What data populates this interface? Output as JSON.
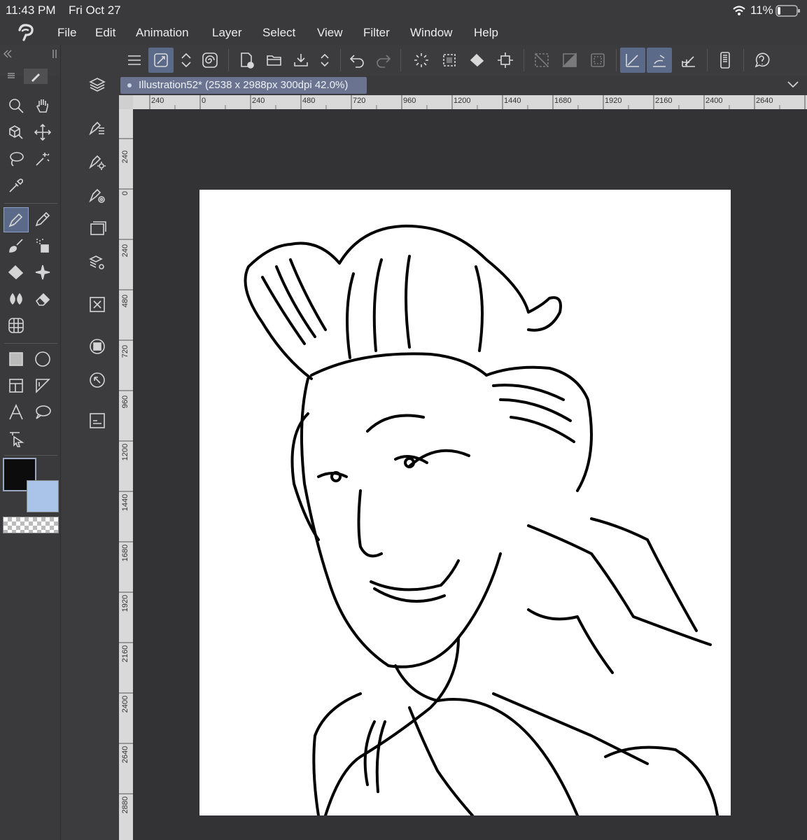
{
  "status_bar": {
    "time": "11:43 PM",
    "date": "Fri Oct 27",
    "battery": "11%"
  },
  "menu": [
    "File",
    "Edit",
    "Animation",
    "Layer",
    "Select",
    "View",
    "Filter",
    "Window",
    "Help"
  ],
  "document_tab": {
    "title": "Illustration52* (2538 x 2988px 300dpi 42.0%)"
  },
  "ruler_h": [
    "240",
    "0",
    "240",
    "480",
    "720",
    "960",
    "1200",
    "1440",
    "1680",
    "1920",
    "2160",
    "2400",
    "2640"
  ],
  "ruler_v": [
    "240",
    "0",
    "240",
    "480",
    "720",
    "960",
    "1200",
    "1440",
    "1680",
    "1920",
    "2160",
    "2400",
    "2640",
    "2880"
  ],
  "colors": {
    "main": "#0c0c0c",
    "sub": "#a9c4e8",
    "accent": "#5a6a88"
  },
  "toolbar_icons": [
    "menu-icon",
    "brush-settings-icon",
    "toggle-icon",
    "spiral-icon",
    "new-file-icon",
    "open-folder-icon",
    "save-icon",
    "updown-icon",
    "undo-icon",
    "redo-icon",
    "loading-icon",
    "select-all-icon",
    "fill-icon",
    "transform-icon",
    "deselect-icon",
    "invert-icon",
    "selection-border-icon",
    "ruler-snap-icon",
    "brush-snap-icon",
    "grid-snap-icon",
    "device-icon",
    "help-icon"
  ],
  "tools": [
    "zoom-icon",
    "hand-icon",
    "object-icon",
    "move-icon",
    "lasso-icon",
    "magic-wand-icon",
    "eyedropper-icon",
    "pen-icon",
    "pencil-icon",
    "brush-icon",
    "airbrush-icon",
    "fill-bucket-icon",
    "sparkle-icon",
    "blend-icon",
    "eraser-icon",
    "grid-icon",
    "gradient-icon",
    "shape-icon",
    "frame-icon",
    "ruler-icon",
    "text-icon",
    "balloon-icon",
    "correct-line-icon"
  ]
}
